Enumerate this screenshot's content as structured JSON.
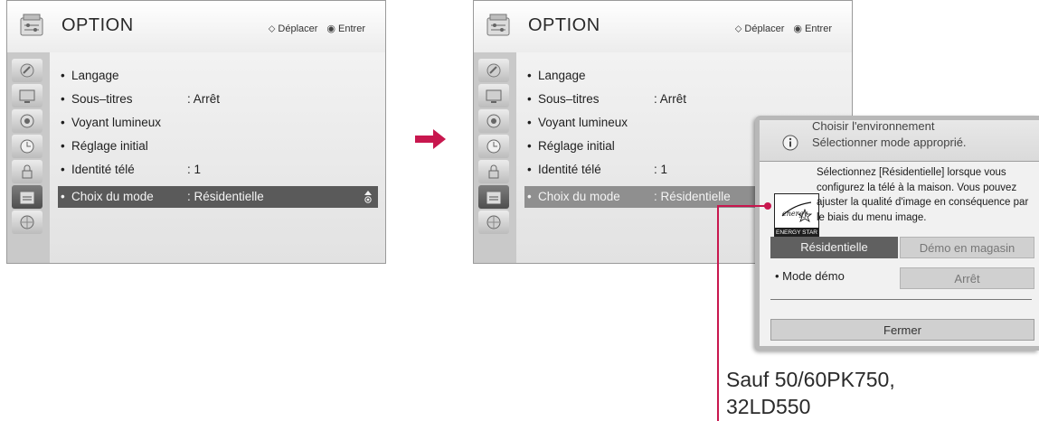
{
  "menu": {
    "title": "OPTION",
    "hint_move": "Déplacer",
    "hint_enter": "Entrer",
    "items": [
      {
        "label": "Langage",
        "value": ""
      },
      {
        "label": "Sous–titres",
        "value": ": Arrêt"
      },
      {
        "label": "Voyant lumineux",
        "value": ""
      },
      {
        "label": "Réglage initial",
        "value": ""
      },
      {
        "label": "Identité télé",
        "value": ": 1"
      },
      {
        "label": "Choix du mode",
        "value": ": Résidentielle",
        "selected": true
      }
    ],
    "categories": [
      "antenna-icon",
      "picture-icon",
      "speaker-icon",
      "clock-icon",
      "lock-icon",
      "option-icon",
      "network-icon"
    ],
    "selected_category": "option-icon"
  },
  "popup": {
    "title_line1": "Choisir l'environnement",
    "title_line2": "Sélectionner mode approprié.",
    "body_lines": [
      "Sélectionnez [Résidentielle] lorsque vous",
      "configurez la télé à la maison. Vous pouvez",
      "ajuster la qualité d'image en conséquence par",
      "le biais du menu image."
    ],
    "logo_script": "energy",
    "logo_caption": "ENERGY STAR",
    "btn_residential": "Résidentielle",
    "btn_store_demo": "Démo en magasin",
    "demo_mode_label": "• Mode démo",
    "demo_mode_value": "Arrêt",
    "close_label": "Fermer"
  },
  "note": {
    "line1": "Sauf 50/60PK750,",
    "line2": "32LD550"
  },
  "colors": {
    "accent": "#c8174e",
    "selected_row": "#5a5a5a"
  }
}
